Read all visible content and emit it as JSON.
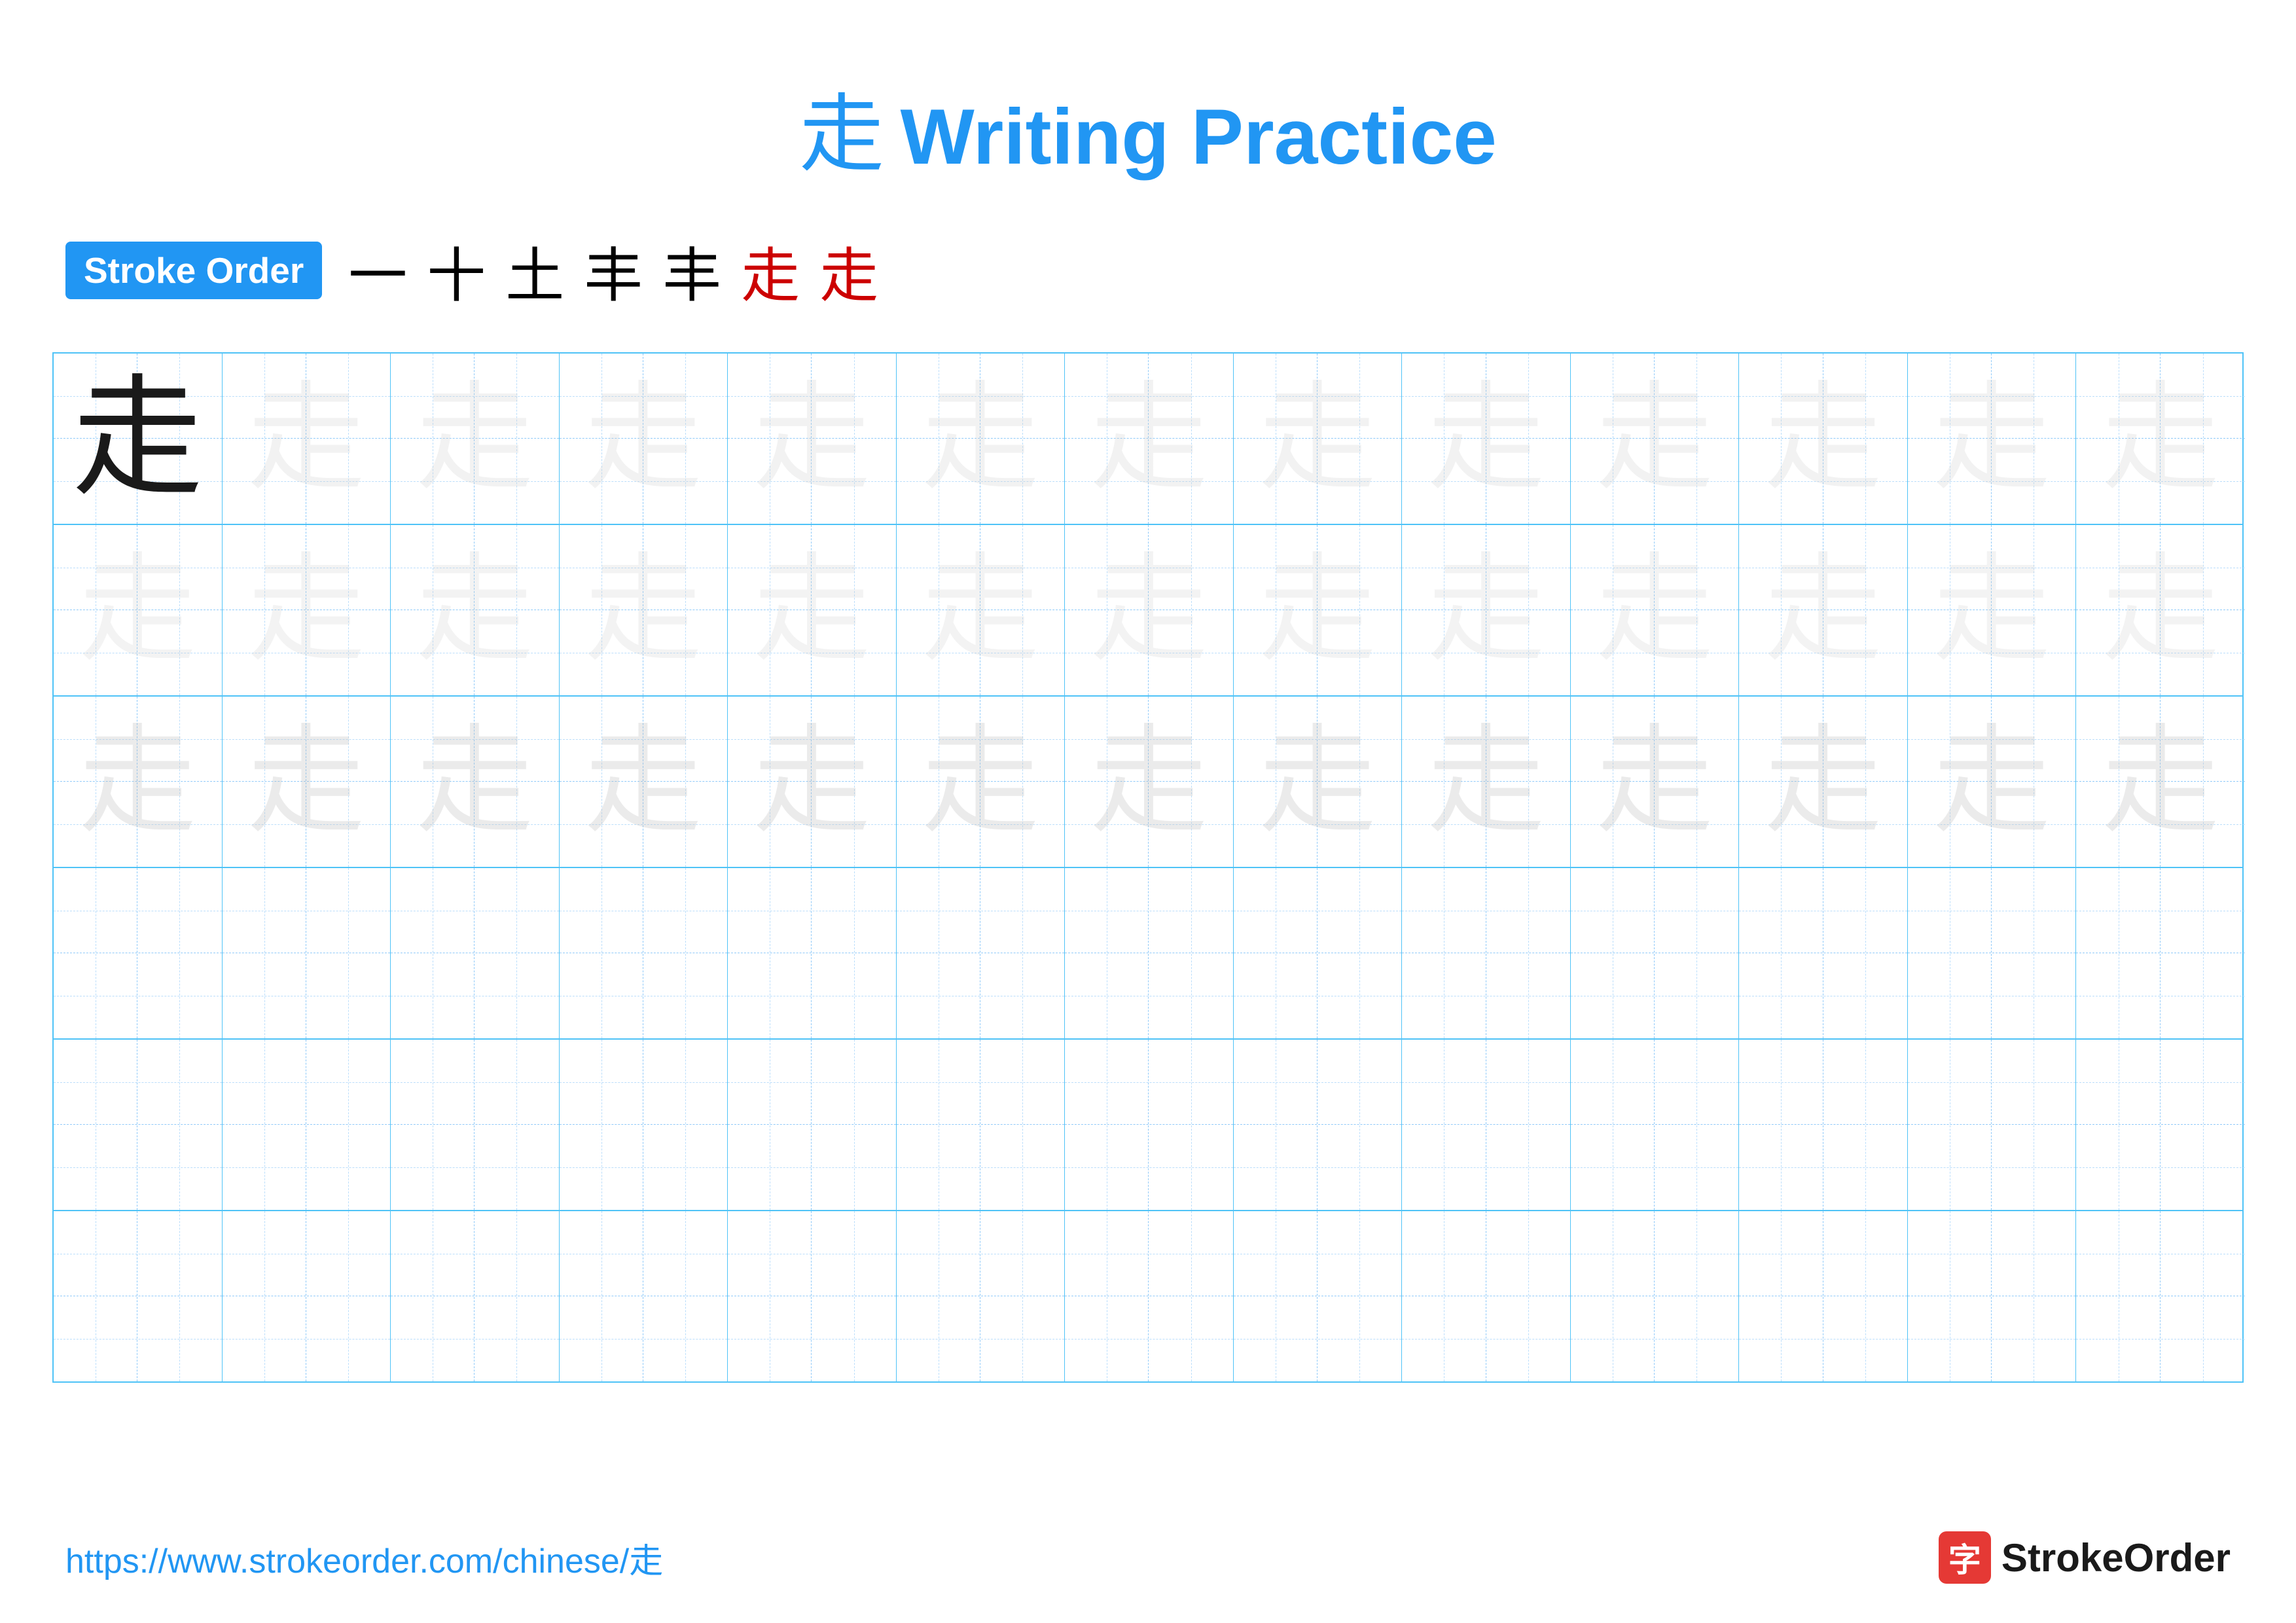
{
  "title": {
    "chinese_char": "走",
    "english_text": "Writing Practice"
  },
  "stroke_order": {
    "badge_label": "Stroke Order",
    "strokes": [
      {
        "char": "一",
        "color": "black"
      },
      {
        "char": "+",
        "color": "black"
      },
      {
        "char": "土",
        "color": "black"
      },
      {
        "char": "丰",
        "color": "black"
      },
      {
        "char": "丰",
        "color": "black"
      },
      {
        "char": "走",
        "color": "red"
      },
      {
        "char": "走",
        "color": "red"
      }
    ]
  },
  "practice_char": "走",
  "grid": {
    "rows": 6,
    "cols": 13,
    "row_types": [
      "solid_then_light",
      "light",
      "medium",
      "empty",
      "empty",
      "empty"
    ]
  },
  "footer": {
    "url": "https://www.strokeorder.com/chinese/走",
    "logo_text": "StrokeOrder",
    "logo_char": "字"
  }
}
